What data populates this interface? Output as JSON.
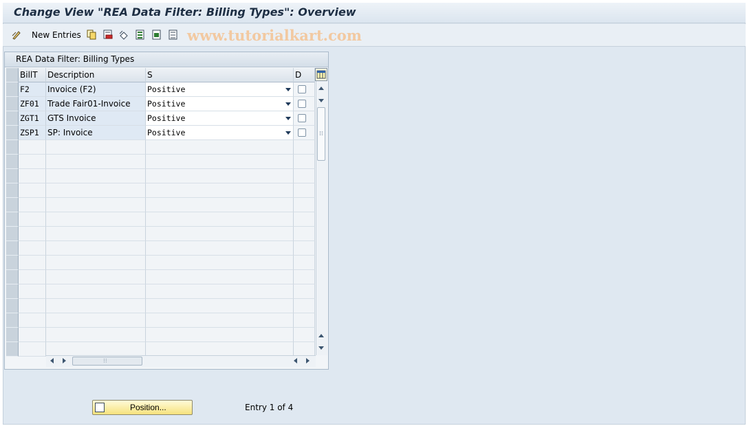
{
  "window": {
    "title": "Change View \"REA Data Filter: Billing Types\": Overview"
  },
  "toolbar": {
    "new_entries_label": "New Entries",
    "icons": [
      "edit-icon",
      "copy-icon",
      "delete-icon",
      "undo-icon",
      "select-all-icon",
      "select-block-icon",
      "deselect-all-icon"
    ],
    "watermark": "www.tutorialkart.com"
  },
  "table": {
    "title": "REA Data Filter: Billing Types",
    "columns": [
      "BillT",
      "Description",
      "S",
      "D"
    ],
    "rows": [
      {
        "billt": "F2",
        "description": "Invoice (F2)",
        "s": "Positive",
        "d": false
      },
      {
        "billt": "ZF01",
        "description": "Trade Fair01-Invoice",
        "s": "Positive",
        "d": false
      },
      {
        "billt": "ZGT1",
        "description": "GTS Invoice",
        "s": "Positive",
        "d": false
      },
      {
        "billt": "ZSP1",
        "description": "SP: Invoice",
        "s": "Positive",
        "d": false
      }
    ],
    "empty_rows": 15
  },
  "footer": {
    "position_button": "Position...",
    "entry_text": "Entry 1 of 4"
  },
  "colors": {
    "title_text": "#1e2f44",
    "background": "#dfe8f1",
    "button_yellow": "#f6e27d"
  }
}
